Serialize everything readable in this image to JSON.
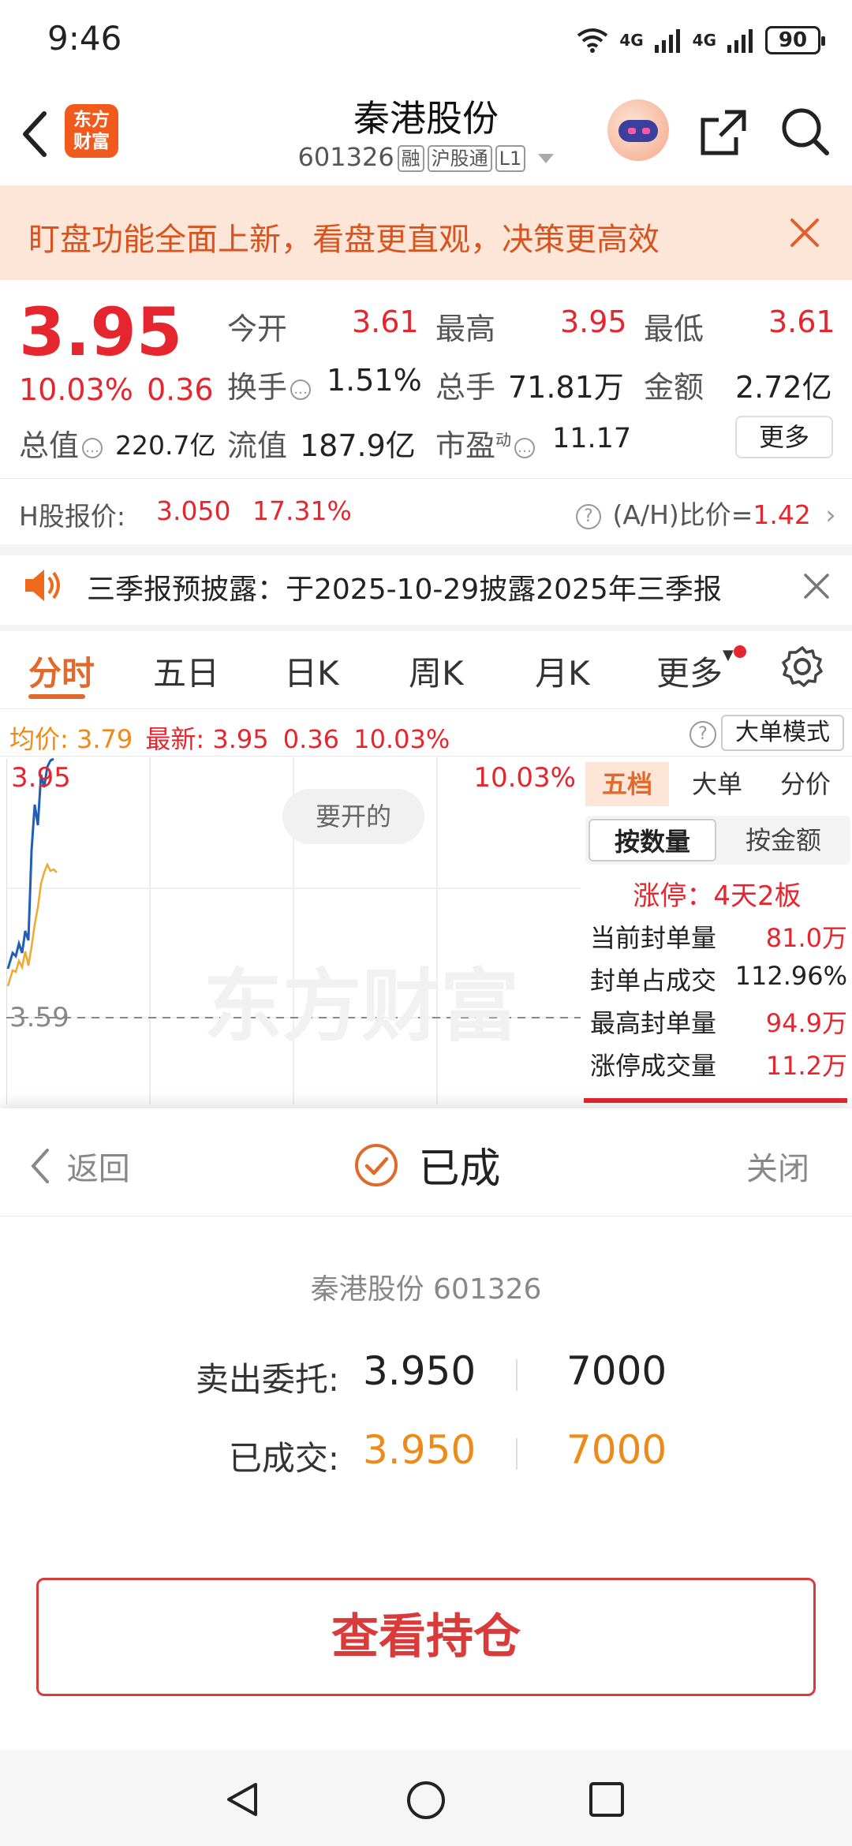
{
  "status_bar": {
    "time": "9:46",
    "net1": "4G",
    "net2": "4G",
    "battery": "90"
  },
  "header": {
    "logo_line1": "东方",
    "logo_line2": "财富",
    "title": "秦港股份",
    "code": "601326",
    "tags": [
      "融",
      "沪股通",
      "L1"
    ]
  },
  "banner": {
    "text": "盯盘功能全面上新，看盘更直观，决策更高效"
  },
  "quote": {
    "price": "3.95",
    "change_pct": "10.03%",
    "change": "0.36",
    "open_label": "今开",
    "open": "3.61",
    "high_label": "最高",
    "high": "3.95",
    "low_label": "最低",
    "low": "3.61",
    "turnover_label": "换手",
    "turnover": "1.51%",
    "volume_label": "总手",
    "volume": "71.81万",
    "amount_label": "金额",
    "amount": "2.72亿",
    "mktcap_label": "总值",
    "mktcap": "220.7亿",
    "float_label": "流值",
    "float": "187.9亿",
    "pe_label": "市盈",
    "pe_sup": "动",
    "pe": "11.17",
    "more_label": "更多"
  },
  "hshare": {
    "label": "H股报价:",
    "price": "3.050",
    "premium": "17.31%",
    "ratio_label": "(A/H)比价=",
    "ratio": "1.42"
  },
  "notice": {
    "text": "三季报预披露：于2025-10-29披露2025年三季报"
  },
  "tabs": [
    "分时",
    "五日",
    "日K",
    "周K",
    "月K",
    "更多"
  ],
  "chart_header": {
    "avg_label": "均价:",
    "avg": "3.79",
    "latest_label": "最新:",
    "latest": "3.95",
    "latest_chg": "0.36",
    "latest_pct": "10.03%",
    "mode_label": "大单模式"
  },
  "chart": {
    "top_price": "3.95",
    "top_pct": "10.03%",
    "base_price": "3.59",
    "bubble": "要开的",
    "watermark": "东方财富"
  },
  "right_panel": {
    "tabs": [
      "五档",
      "大单",
      "分价"
    ],
    "subtabs": [
      "按数量",
      "按金额"
    ],
    "limit_up": "涨停：4天2板",
    "rows": [
      {
        "label": "当前封单量",
        "value": "81.0万"
      },
      {
        "label": "封单占成交",
        "value": "112.96%"
      },
      {
        "label": "最高封单量",
        "value": "94.9万"
      },
      {
        "label": "涨停成交量",
        "value": "11.2万"
      }
    ]
  },
  "dialog": {
    "back_label": "返回",
    "status_label": "已成",
    "close_label": "关闭",
    "stock_line": "秦港股份 601326",
    "sell_label": "卖出委托:",
    "sell_price": "3.950",
    "sell_qty": "7000",
    "filled_label": "已成交:",
    "filled_price": "3.950",
    "filled_qty": "7000",
    "position_button": "查看持仓"
  },
  "colors": {
    "accent_red": "#e5262e",
    "accent_orange": "#ef8a16",
    "brand": "#f05a1d"
  }
}
